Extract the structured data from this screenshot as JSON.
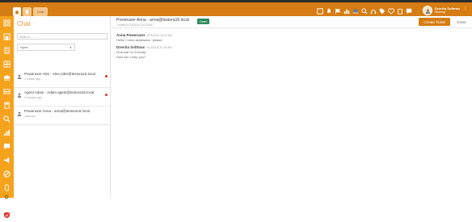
{
  "topbar": {
    "tabs": [
      {
        "label": ""
      },
      {
        "label": ""
      },
      {
        "label": "Chat"
      }
    ],
    "user": {
      "name": "Dzenita Softmax",
      "status": "Working"
    },
    "icons": [
      "dashboard-icon",
      "bell-icon",
      "flag-icon",
      "chart-icon",
      "laptop-icon",
      "search-icon",
      "headset-icon",
      "tag-icon",
      "heart-icon",
      "clipboard-icon",
      "chat-icon"
    ]
  },
  "sidebar": {
    "icons": [
      "apps-icon",
      "home-icon",
      "list-icon",
      "grid-icon",
      "graduation-icon",
      "inbox-icon",
      "calculator-icon",
      "search-icon",
      "bar-chart-icon",
      "comment-icon",
      "megaphone-icon",
      "ban-icon",
      "mobile-icon",
      "document-icon",
      "shield-icon",
      "gear-icon"
    ]
  },
  "chat_panel": {
    "title": "Chat",
    "search_placeholder": "Search...",
    "filter_value": "Open",
    "items": [
      {
        "title": "Poweruser Alex - Alex.rider@testora16.local",
        "sub": "1 minute ago",
        "unread": true
      },
      {
        "title": "Agent Adam - Adam.agent@testora16.local",
        "sub": "2 minutes ago",
        "unread": true
      },
      {
        "title": "Poweruser Anna - anna@testora16.local",
        "sub": "Just now",
        "unread": false
      }
    ]
  },
  "conversation": {
    "title": "Poweruser Anna - anna@testora16.local",
    "subtitle": "Created 6/13/2024 10:15 AM",
    "status": "Open",
    "create_ticket_label": "Create Ticket",
    "close_label": "Close",
    "messages": [
      {
        "author": "Anna Poweruser",
        "time": "6/13/2024 10:15 AM",
        "lines": [
          "Hello! I need assistance, please."
        ]
      },
      {
        "author": "Dzenita Softmax",
        "time": "6/13/2024 10:15 AM",
        "lines": [
          "Hi Anna! I'm Dzenita.",
          "How can I help you?"
        ]
      }
    ]
  },
  "colors": {
    "accent": "#d57c12",
    "sidebar": "#f5a21d",
    "status_open": "#2c8a5a",
    "unread": "#e0322a"
  }
}
